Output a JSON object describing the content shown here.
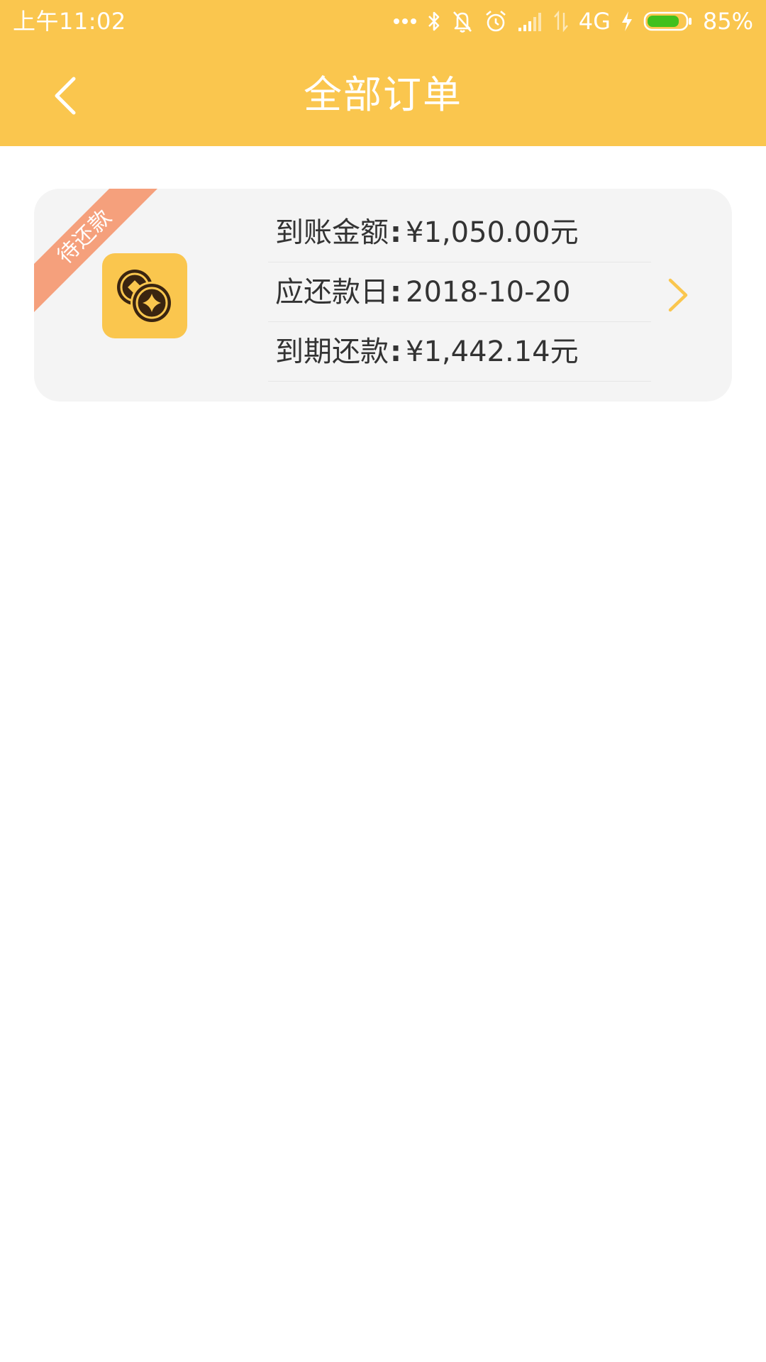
{
  "status_bar": {
    "time": "上午11:02",
    "network": "4G",
    "battery_percent": "85%",
    "battery_level": 0.85,
    "icons": [
      "more-dots-icon",
      "bluetooth-icon",
      "mute-bell-icon",
      "alarm-icon",
      "signal-icon",
      "data-arrows-icon",
      "charging-bolt-icon",
      "battery-icon"
    ]
  },
  "title_bar": {
    "title": "全部订单",
    "back_icon": "chevron-left-icon"
  },
  "order": {
    "status_tag": "待还款",
    "logo_icon": "coins-icon",
    "rows": [
      {
        "label": "到账金额",
        "colon": ":",
        "value": "¥1,050.00元"
      },
      {
        "label": "应还款日",
        "colon": ":",
        "value": "2018-10-20"
      },
      {
        "label": "到期还款",
        "colon": ":",
        "value": "¥1,442.14元"
      }
    ],
    "chevron_icon": "chevron-right-icon"
  },
  "colors": {
    "header_bg": "#FAC64E",
    "card_bg": "#F4F4F4",
    "ribbon_bg": "#F5A07C",
    "battery_fill": "#41C01D",
    "chevron": "#FAC64E",
    "text_primary": "#333333"
  }
}
